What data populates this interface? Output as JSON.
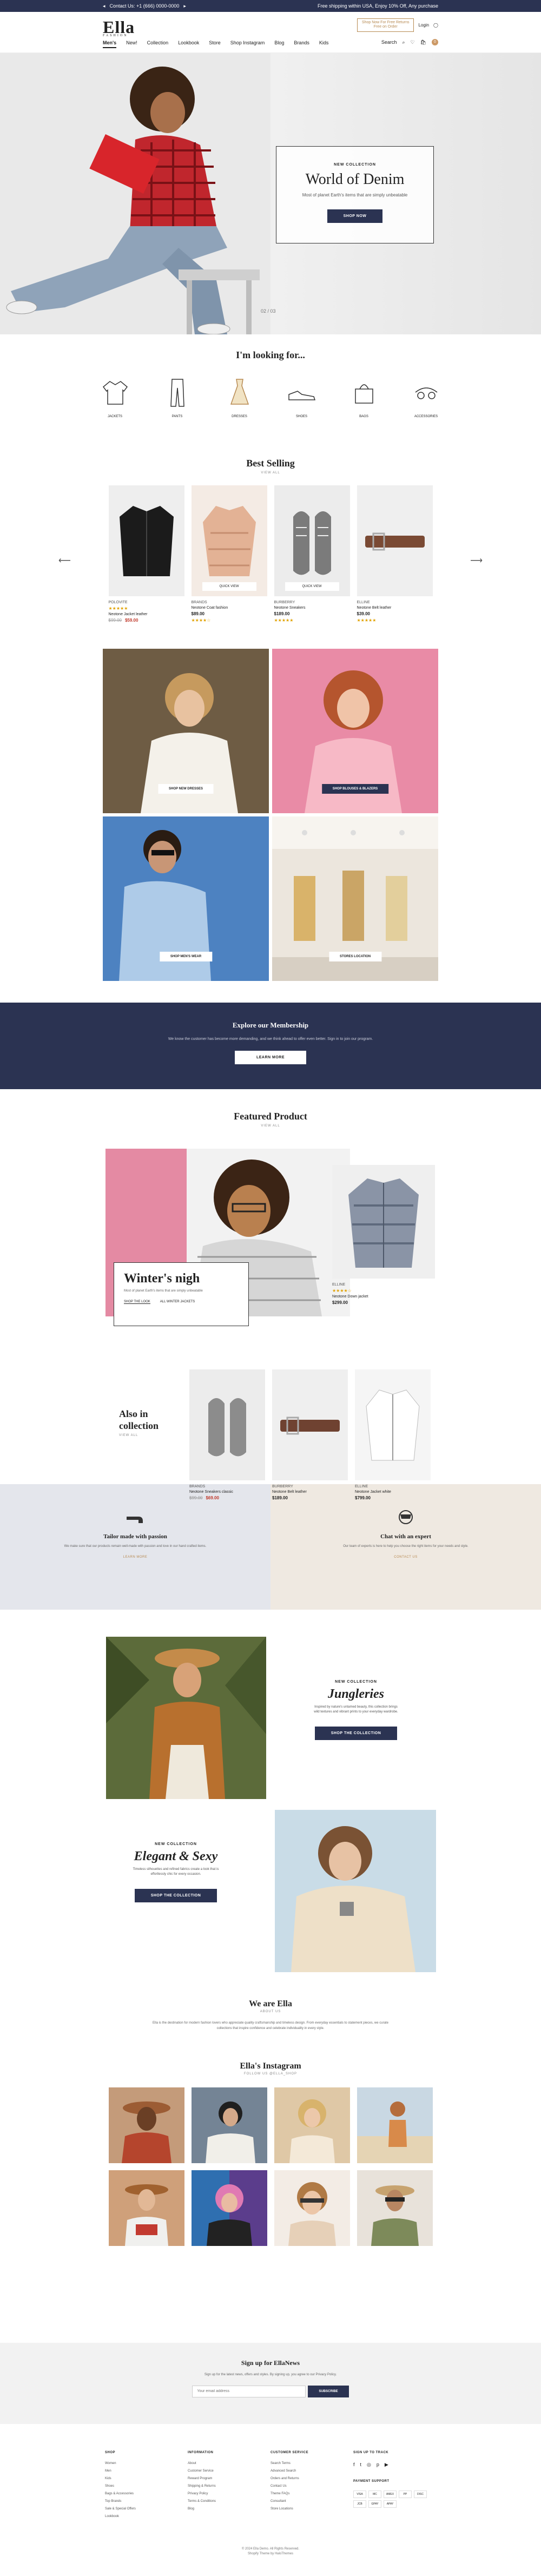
{
  "topbar": {
    "left_text": "Contact Us: +1 (666) 0000-0000",
    "center_text": "Free shipping within USA, Enjoy 10% Off, Any purchase",
    "lang": "EN",
    "currency": "USD"
  },
  "header": {
    "logo": "Ella",
    "logo_sub": "FASHION",
    "promo_line1": "Shop Now For Free Returns",
    "promo_line2": "Free on Order",
    "account_label": "Login",
    "nav": [
      "Men's",
      "New!",
      "Collection",
      "Lookbook",
      "Store",
      "Shop Instagram",
      "Blog",
      "Brands",
      "Kids"
    ],
    "search_label": "Search",
    "cart_count": "0"
  },
  "hero": {
    "eyebrow": "NEW COLLECTION",
    "title": "World of Denim",
    "text": "Most of planet Earth's items that are simply unbeatable",
    "button": "SHOP NOW",
    "pager": "02 / 03"
  },
  "looking": {
    "title": "I'm looking for...",
    "categories": [
      "JACKETS",
      "PANTS",
      "DRESSES",
      "SHOES",
      "BAGS",
      "ACCESSORIES"
    ]
  },
  "bestselling": {
    "title": "Best Selling",
    "view_all": "VIEW ALL",
    "products": [
      {
        "vendor": "POLOVITE",
        "name": "Neotone Jacket leather",
        "old": "$99.00",
        "price": "$59.00",
        "stars": "★★★★★",
        "quick": ""
      },
      {
        "vendor": "BRANDS",
        "name": "Neotone Coat fashion",
        "old": "",
        "price": "$89.00",
        "stars": "★★★★☆",
        "quick": "QUICK VIEW"
      },
      {
        "vendor": "BURBERRY",
        "name": "Neotone Sneakers",
        "old": "",
        "price": "$189.00",
        "stars": "★★★★★",
        "quick": "QUICK VIEW"
      },
      {
        "vendor": "ELLINE",
        "name": "Neotone Belt leather",
        "old": "",
        "price": "$39.00",
        "stars": "★★★★★",
        "quick": ""
      }
    ]
  },
  "lookbook": {
    "tags": [
      "SHOP NEW DRESSES",
      "SHOP BLOUSES & BLAZERS",
      "SHOP MEN'S WEAR",
      "STORES LOCATION"
    ]
  },
  "membership": {
    "title": "Explore our Membership",
    "text": "We know the customer has become more demanding, and we think ahead to offer even better. Sign in to join our program.",
    "button": "LEARN MORE"
  },
  "featured": {
    "title": "Featured Product",
    "view_all": "VIEW ALL",
    "winter_title": "Winter's nigh",
    "winter_text": "Most of planet Earth's items that are simply unbeatable",
    "winter_link1": "SHOP THE LOOK",
    "winter_link2": "ALL WINTER JACKETS",
    "jacket": {
      "vendor": "ELLINE",
      "name": "Neotone Down jacket",
      "price": "$299.00",
      "stars": "★★★★☆"
    },
    "also_title1": "Also in",
    "also_title2": "collection",
    "also_view": "VIEW ALL",
    "also_products": [
      {
        "vendor": "BRANDS",
        "name": "Neotone Sneakers classic",
        "old": "$99.00",
        "price": "$69.00"
      },
      {
        "vendor": "BURBERRY",
        "name": "Neotone Belt leather",
        "old": "",
        "price": "$189.00"
      },
      {
        "vendor": "ELLINE",
        "name": "Neotone Jacket white",
        "old": "",
        "price": "$799.00"
      }
    ]
  },
  "services": [
    {
      "title": "Tailor made with passion",
      "text": "We make sure that our products remain well-made with passion and love in our hand crafted items.",
      "link": "LEARN MORE"
    },
    {
      "title": "Chat with an expert",
      "text": "Our team of experts is here to help you choose the right items for your needs and style.",
      "link": "CONTACT US"
    }
  ],
  "editorial": {
    "eyebrow1": "NEW COLLECTION",
    "title1": "Jungleries",
    "text1": "Inspired by nature's untamed beauty, this collection brings wild textures and vibrant prints to your everyday wardrobe.",
    "button1": "SHOP THE COLLECTION",
    "eyebrow2": "NEW COLLECTION",
    "title2": "Elegant & Sexy",
    "text2": "Timeless silhouettes and refined fabrics create a look that is effortlessly chic for every occasion.",
    "button2": "SHOP THE COLLECTION"
  },
  "about": {
    "title": "We are Ella",
    "sub": "ABOUT US",
    "text": "Ella is the destination for modern fashion lovers who appreciate quality craftsmanship and timeless design. From everyday essentials to statement pieces, we curate collections that inspire confidence and celebrate individuality in every style."
  },
  "instagram": {
    "title": "Ella's Instagram",
    "sub": "FOLLOW US @ELLA_SHOP"
  },
  "newsletter": {
    "title": "Sign up for EllaNews",
    "text": "Sign up for the latest news, offers and styles. By signing up, you agree to our Privacy Policy.",
    "placeholder": "Your email address",
    "button": "SUBSCRIBE"
  },
  "footer": {
    "cols": [
      {
        "title": "SHOP",
        "items": [
          "Women",
          "Men",
          "Kids",
          "Shoes",
          "Bags & Accessories",
          "Top Brands",
          "Sale & Special Offers",
          "Lookbook"
        ]
      },
      {
        "title": "INFORMATION",
        "items": [
          "About",
          "Customer Service",
          "Reward Program",
          "Shipping & Returns",
          "Privacy Policy",
          "Terms & Conditions",
          "Blog"
        ]
      },
      {
        "title": "CUSTOMER SERVICE",
        "items": [
          "Search Terms",
          "Advanced Search",
          "Orders and Returns",
          "Contact Us",
          "Theme FAQs",
          "Consultant",
          "Store Locations"
        ]
      }
    ],
    "social_title": "SIGN UP TO TRACK",
    "payment_title": "PAYMENT SUPPORT",
    "payments": [
      "VISA",
      "MC",
      "AMEX",
      "PP",
      "DISC",
      "JCB",
      "GPAY",
      "APAY"
    ],
    "copyright": "© 2024 Ella Demo. All Rights Reserved.",
    "credit": "Shopify Theme by HaloThemes"
  }
}
